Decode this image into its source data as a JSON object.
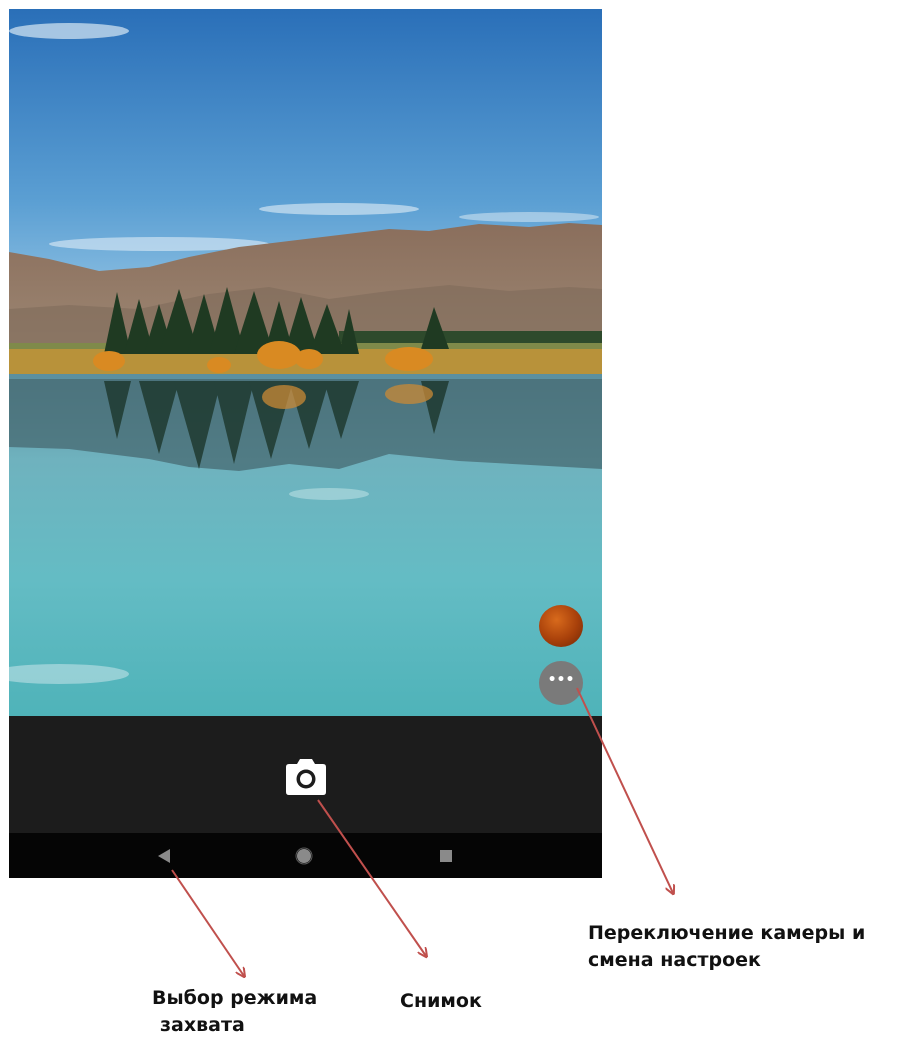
{
  "screen": {
    "viewfinder_scene": "lake-landscape",
    "capture_bar": {
      "shutter_icon": "camera-icon"
    },
    "side_controls": {
      "color_button_color": "#a8400a",
      "more_icon": "more-horizontal-icon"
    },
    "nav_bar": {
      "back_icon": "back-triangle-icon",
      "home_icon": "home-circle-icon",
      "recents_icon": "recents-square-icon"
    }
  },
  "annotations": {
    "capture_mode": {
      "line1": "Выбор режима",
      "line2": "захвата"
    },
    "snapshot": "Снимок",
    "camera_switch": {
      "line1": "Переключение камеры и",
      "line2": "смена настроек"
    },
    "arrow_color": "#c0504d"
  }
}
